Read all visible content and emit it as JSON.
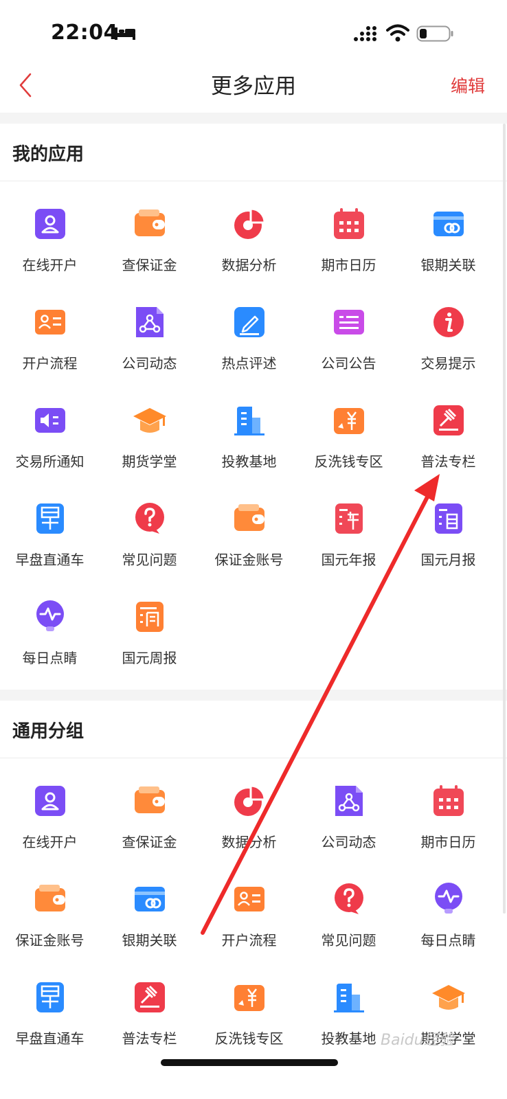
{
  "status_bar": {
    "time": "22:04"
  },
  "nav": {
    "title": "更多应用",
    "edit_label": "编辑"
  },
  "colors": {
    "accent": "#e03b3b",
    "purple": "#7b4df5",
    "orange": "#ff7a2e",
    "red": "#ef3b4a",
    "blue": "#2a8bff",
    "magenta": "#c94be8"
  },
  "my_apps": {
    "title": "我的应用",
    "items": [
      {
        "label": "在线开户",
        "icon": "user-card-icon"
      },
      {
        "label": "查保证金",
        "icon": "wallet-icon"
      },
      {
        "label": "数据分析",
        "icon": "pie-chart-icon"
      },
      {
        "label": "期市日历",
        "icon": "calendar-icon"
      },
      {
        "label": "银期关联",
        "icon": "bank-link-icon"
      },
      {
        "label": "开户流程",
        "icon": "id-card-icon"
      },
      {
        "label": "公司动态",
        "icon": "share-doc-icon"
      },
      {
        "label": "热点评述",
        "icon": "edit-pen-icon"
      },
      {
        "label": "公司公告",
        "icon": "notice-icon"
      },
      {
        "label": "交易提示",
        "icon": "info-icon"
      },
      {
        "label": "交易所通知",
        "icon": "speaker-icon"
      },
      {
        "label": "期货学堂",
        "icon": "graduation-cap-icon"
      },
      {
        "label": "投教基地",
        "icon": "building-icon"
      },
      {
        "label": "反洗钱专区",
        "icon": "yen-icon"
      },
      {
        "label": "普法专栏",
        "icon": "gavel-icon"
      },
      {
        "label": "早盘直通车",
        "icon": "morning-icon"
      },
      {
        "label": "常见问题",
        "icon": "question-icon"
      },
      {
        "label": "保证金账号",
        "icon": "wallet-icon"
      },
      {
        "label": "国元年报",
        "icon": "year-report-icon"
      },
      {
        "label": "国元月报",
        "icon": "month-report-icon"
      },
      {
        "label": "每日点睛",
        "icon": "bulb-icon"
      },
      {
        "label": "国元周报",
        "icon": "week-report-icon"
      }
    ]
  },
  "common_group": {
    "title": "通用分组",
    "items": [
      {
        "label": "在线开户",
        "icon": "user-card-icon"
      },
      {
        "label": "查保证金",
        "icon": "wallet-icon"
      },
      {
        "label": "数据分析",
        "icon": "pie-chart-icon"
      },
      {
        "label": "公司动态",
        "icon": "share-doc-icon"
      },
      {
        "label": "期市日历",
        "icon": "calendar-icon"
      },
      {
        "label": "保证金账号",
        "icon": "wallet-icon"
      },
      {
        "label": "银期关联",
        "icon": "bank-link-icon"
      },
      {
        "label": "开户流程",
        "icon": "id-card-icon"
      },
      {
        "label": "常见问题",
        "icon": "question-icon"
      },
      {
        "label": "每日点睛",
        "icon": "bulb-icon"
      },
      {
        "label": "早盘直通车",
        "icon": "morning-icon"
      },
      {
        "label": "普法专栏",
        "icon": "gavel-icon"
      },
      {
        "label": "反洗钱专区",
        "icon": "yen-icon"
      },
      {
        "label": "投教基地",
        "icon": "building-icon"
      },
      {
        "label": "期货学堂",
        "icon": "graduation-cap-icon"
      }
    ]
  },
  "watermark": "Baidu经验"
}
